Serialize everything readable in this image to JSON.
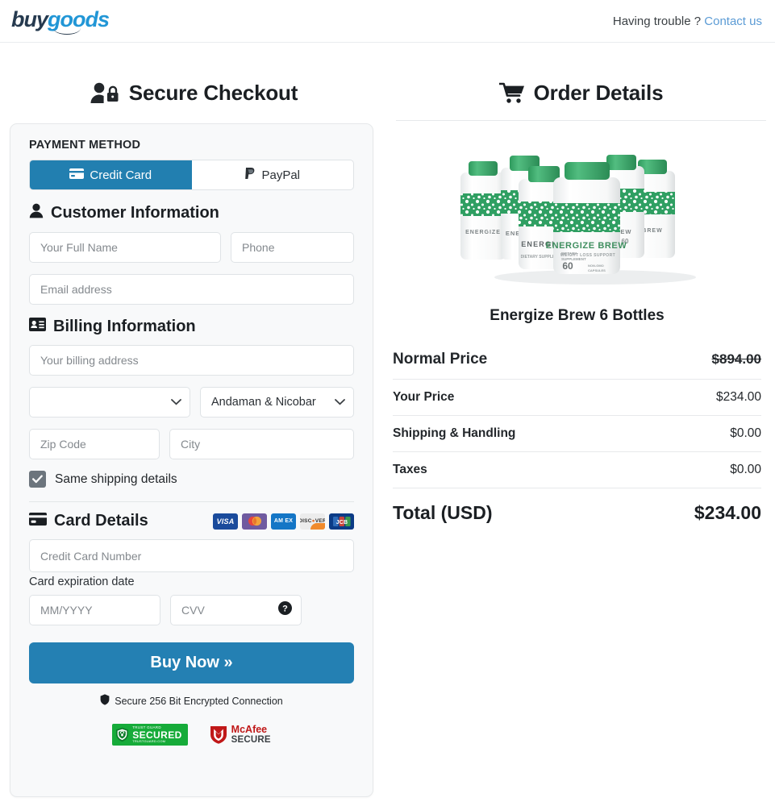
{
  "header": {
    "logo_buy": "buy",
    "logo_goods": "goods",
    "help_text": "Having trouble ?",
    "help_link": "Contact us"
  },
  "checkout": {
    "title": "Secure Checkout",
    "title_icon": "user-lock-icon",
    "payment_method_label": "PAYMENT METHOD",
    "payment_options": [
      {
        "label": "Credit Card",
        "icon": "credit-card-icon",
        "active": true
      },
      {
        "label": "PayPal",
        "icon": "paypal-icon",
        "active": false
      }
    ],
    "customer": {
      "heading": "Customer Information",
      "heading_icon": "user-icon",
      "full_name_placeholder": "Your Full Name",
      "full_name_value": "",
      "phone_placeholder": "Phone",
      "phone_value": "",
      "email_placeholder": "Email address",
      "email_value": ""
    },
    "billing": {
      "heading": "Billing Information",
      "heading_icon": "id-card-icon",
      "address_placeholder": "Your billing address",
      "address_value": "",
      "country_value": "",
      "state_value": "Andaman & Nicobar",
      "zip_placeholder": "Zip Code",
      "zip_value": "",
      "city_placeholder": "City",
      "city_value": "",
      "same_shipping_label": "Same shipping details",
      "same_shipping_checked": true
    },
    "card": {
      "heading": "Card Details",
      "heading_icon": "credit-card-icon",
      "brands": [
        "VISA",
        "MASTERCARD",
        "AM EX",
        "DISCOVER",
        "JCB"
      ],
      "number_placeholder": "Credit Card Number",
      "number_value": "",
      "expiry_label": "Card expiration date",
      "expiry_placeholder": "MM/YYYY",
      "expiry_value": "",
      "cvv_placeholder": "CVV",
      "cvv_value": "",
      "cvv_help_icon": "question-circle-icon"
    },
    "buy_button": "Buy Now »",
    "secure_note": "Secure 256 Bit Encrypted Connection",
    "secure_note_icon": "shield-icon",
    "badges": [
      {
        "name": "trust-guard-secured",
        "top": "TRUST GUARD",
        "main": "SECURED",
        "bottom": "TRUSTGUARD.COM"
      },
      {
        "name": "mcafee-secure",
        "main": "McAfee",
        "sub": "SECURE"
      }
    ]
  },
  "order": {
    "title": "Order Details",
    "title_icon": "shopping-cart-icon",
    "product_image_alt": "Energize Brew six bottle supplement pack",
    "product_label_brand": "ENERGIZE BREW",
    "product_label_sub": "WEIGHT LOSS SUPPORT",
    "product_label_count": "60",
    "product_label_caps": "NON-GMO CAPSULES",
    "product_label_dietary": "DIETARY SUPPLEMENT",
    "product_name": "Energize Brew 6 Bottles",
    "lines": [
      {
        "label": "Normal Price",
        "value": "$894.00",
        "strike": true
      },
      {
        "label": "Your Price",
        "value": "$234.00",
        "strike": false
      },
      {
        "label": "Shipping & Handling",
        "value": "$0.00",
        "strike": false
      },
      {
        "label": "Taxes",
        "value": "$0.00",
        "strike": false
      }
    ],
    "total_label": "Total (USD)",
    "total_value": "$234.00"
  },
  "colors": {
    "accent_blue": "#2480b3",
    "link_blue": "#5b9bd5",
    "price_red": "#e2495b",
    "card_bg": "#f8f9fa"
  }
}
